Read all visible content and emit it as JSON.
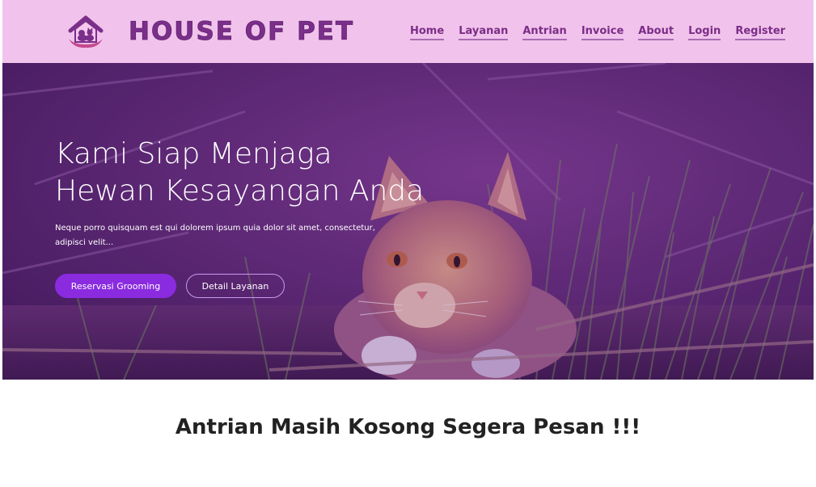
{
  "brand": {
    "name": "HOUSE OF PET",
    "logo_icon": "house-pet-logo-icon",
    "color": "#7a2f8a"
  },
  "nav": {
    "items": [
      {
        "label": "Home"
      },
      {
        "label": "Layanan"
      },
      {
        "label": "Antrian"
      },
      {
        "label": "Invoice"
      },
      {
        "label": "About"
      },
      {
        "label": "Login"
      },
      {
        "label": "Register"
      }
    ],
    "background": "#f1c3ec",
    "link_color": "#7b2d86"
  },
  "hero": {
    "title_line1": "Kami Siap Menjaga",
    "title_line2": "Hewan Kesayangan Anda",
    "description": "Neque porro quisquam est qui dolorem ipsum quia dolor sit amet, consectetur, adipisci velit...",
    "primary_button": "Reservasi Grooming",
    "secondary_button": "Detail Layanan",
    "image": "orange-cat-in-grass",
    "overlay_color": "#5f197d",
    "button_color": "#8a2be0"
  },
  "queue": {
    "message": "Antrian Masih Kosong Segera Pesan !!!"
  }
}
